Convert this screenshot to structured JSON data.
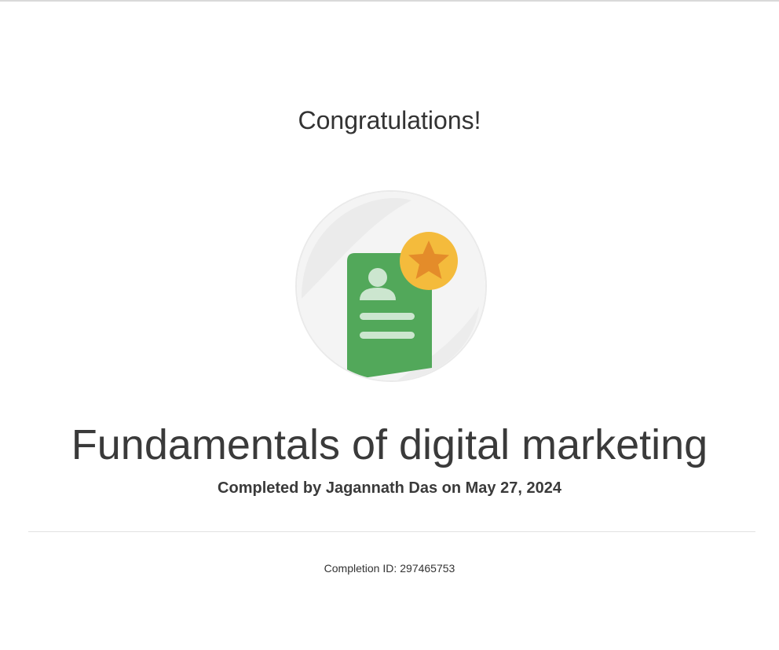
{
  "heading": "Congratulations!",
  "badge": {
    "icon": "certificate-star-icon",
    "colors": {
      "circle_bg": "#eeeeee",
      "document": "#52a85a",
      "document_lines": "#cce6cf",
      "star_circle": "#f4bb3c",
      "star": "#e48c2a"
    }
  },
  "course": {
    "title": "Fundamentals of digital marketing",
    "completed_text": "Completed by Jagannath Das on May 27, 2024"
  },
  "completion": {
    "label": "Completion ID:",
    "id": "297465753"
  }
}
